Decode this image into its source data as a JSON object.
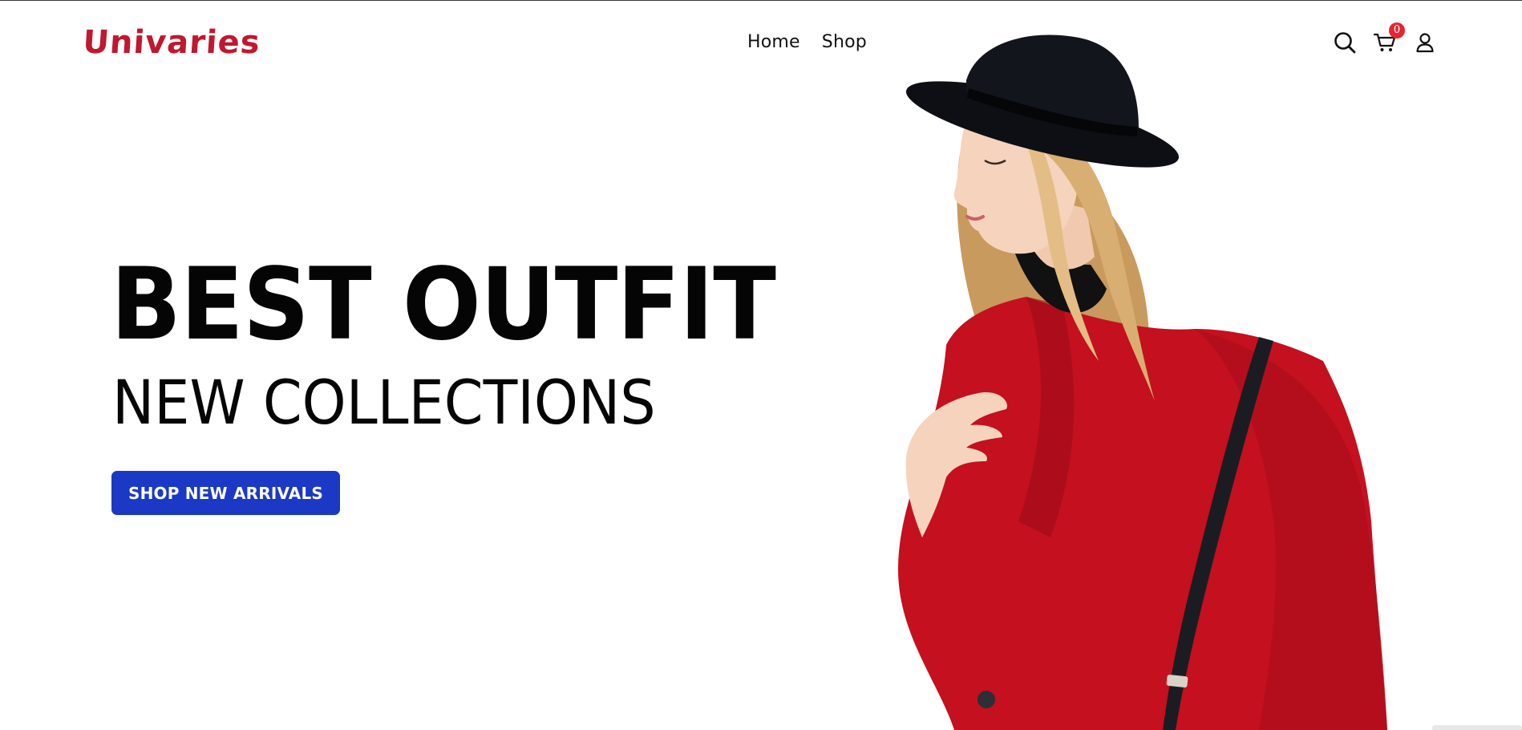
{
  "brand": {
    "name": "Univaries",
    "color": "#c0182f"
  },
  "nav": {
    "items": [
      {
        "label": "Home"
      },
      {
        "label": "Shop"
      }
    ]
  },
  "header_icons": {
    "search": "search-icon",
    "cart": "cart-icon",
    "account": "user-icon",
    "cart_count": "0"
  },
  "hero": {
    "title": "BEST OUTFIT",
    "subtitle": "NEW COLLECTIONS",
    "cta_label": "SHOP NEW ARRIVALS",
    "cta_color": "#1b39c5",
    "image": "woman-in-red-coat-and-black-hat"
  }
}
